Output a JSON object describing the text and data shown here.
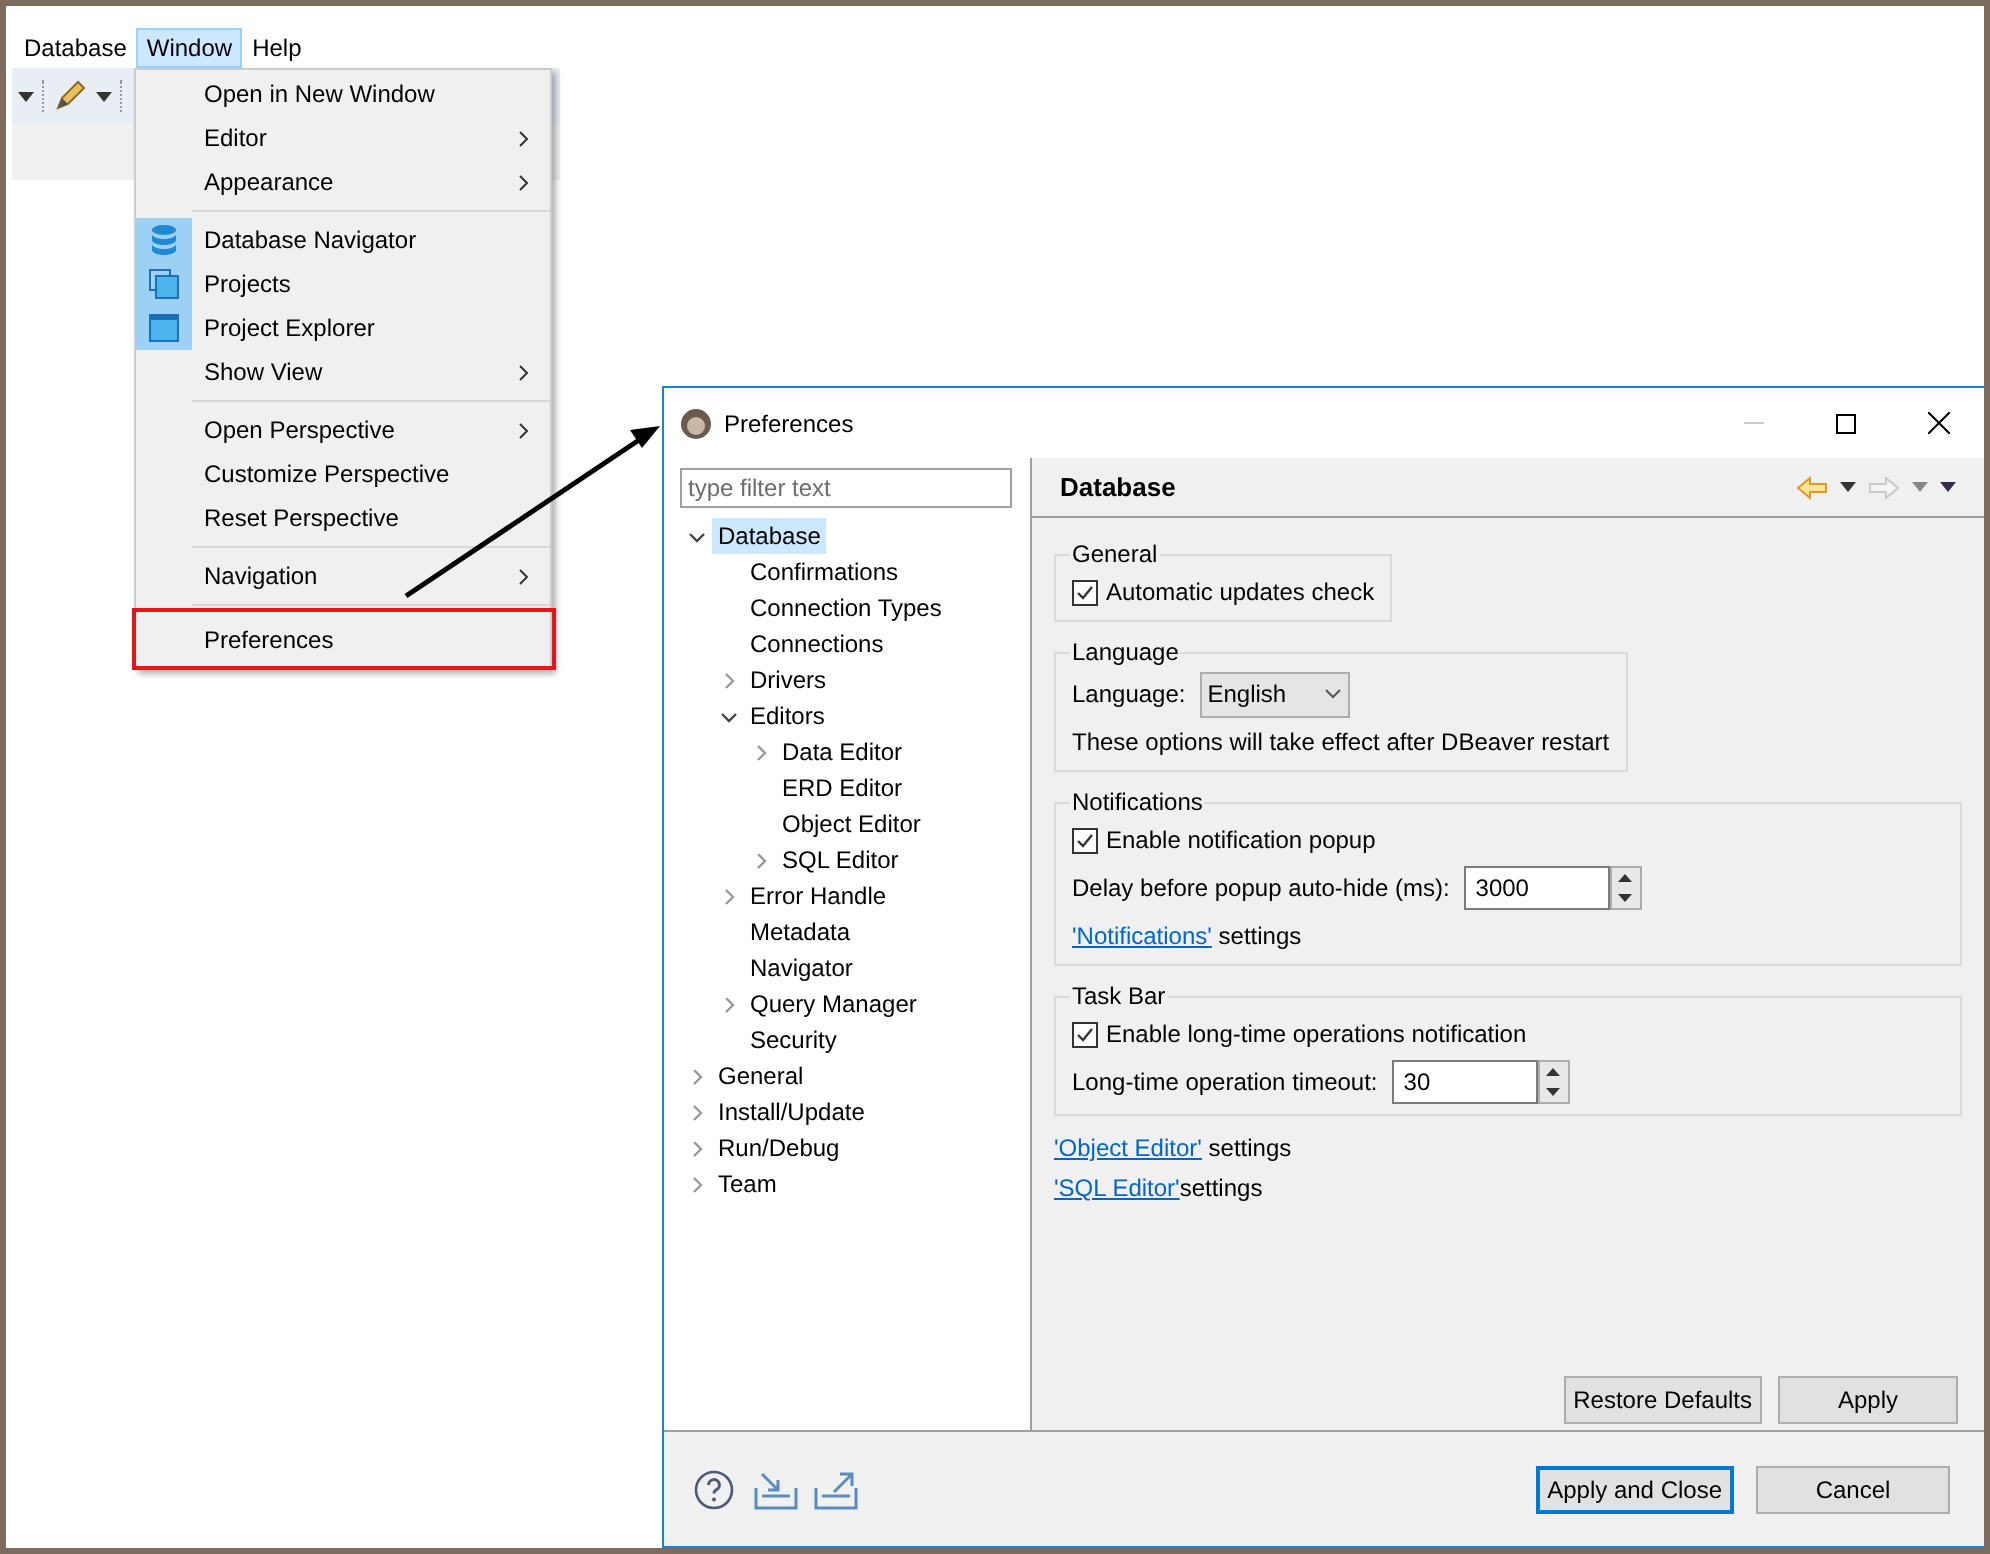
{
  "menu_bar": [
    {
      "label": "Database",
      "selected": false
    },
    {
      "label": "Window",
      "selected": true
    },
    {
      "label": "Help",
      "selected": false
    }
  ],
  "menu": {
    "groups": [
      [
        {
          "label": "Open in New Window",
          "submenu": false,
          "icon": false,
          "highlighted": false
        },
        {
          "label": "Editor",
          "submenu": true,
          "icon": false,
          "highlighted": false
        },
        {
          "label": "Appearance",
          "submenu": true,
          "icon": false,
          "highlighted": false
        }
      ],
      [
        {
          "label": "Database Navigator",
          "submenu": false,
          "icon": true,
          "highlighted": false
        },
        {
          "label": "Projects",
          "submenu": false,
          "icon": true,
          "highlighted": false
        },
        {
          "label": "Project Explorer",
          "submenu": false,
          "icon": true,
          "highlighted": false
        },
        {
          "label": "Show View",
          "submenu": true,
          "icon": false,
          "highlighted": false
        }
      ],
      [
        {
          "label": "Open Perspective",
          "submenu": true,
          "icon": false,
          "highlighted": false
        },
        {
          "label": "Customize Perspective",
          "submenu": false,
          "icon": false,
          "highlighted": false
        },
        {
          "label": "Reset Perspective",
          "submenu": false,
          "icon": false,
          "highlighted": false
        }
      ],
      [
        {
          "label": "Navigation",
          "submenu": true,
          "icon": false,
          "highlighted": false
        }
      ],
      [
        {
          "label": "Preferences",
          "submenu": false,
          "icon": false,
          "highlighted": true
        }
      ]
    ]
  },
  "dialog": {
    "title": "Preferences",
    "filter": {
      "placeholder": "type filter text"
    },
    "tree": [
      {
        "label": "Database",
        "selected": true,
        "expanded": true,
        "children": [
          {
            "label": "Confirmations",
            "selected": false
          },
          {
            "label": "Connection Types",
            "selected": false
          },
          {
            "label": "Connections",
            "selected": false
          },
          {
            "label": "Drivers",
            "selected": false,
            "expanded": false
          },
          {
            "label": "Editors",
            "selected": false,
            "expanded": true,
            "children": [
              {
                "label": "Data Editor",
                "selected": false,
                "expanded": false
              },
              {
                "label": "ERD Editor",
                "selected": false
              },
              {
                "label": "Object Editor",
                "selected": false
              },
              {
                "label": "SQL Editor",
                "selected": false,
                "expanded": false
              }
            ]
          },
          {
            "label": "Error Handle",
            "selected": false,
            "expanded": false
          },
          {
            "label": "Metadata",
            "selected": false
          },
          {
            "label": "Navigator",
            "selected": false
          },
          {
            "label": "Query Manager",
            "selected": false,
            "expanded": false
          },
          {
            "label": "Security",
            "selected": false
          }
        ]
      },
      {
        "label": "General",
        "selected": false,
        "expanded": false
      },
      {
        "label": "Install/Update",
        "selected": false,
        "expanded": false
      },
      {
        "label": "Run/Debug",
        "selected": false,
        "expanded": false
      },
      {
        "label": "Team",
        "selected": false,
        "expanded": false
      }
    ],
    "page_title": "Database",
    "groups": [
      {
        "title": "General",
        "rows": [
          {
            "kind": "checkbox",
            "label": "Automatic updates check",
            "checked": true
          }
        ]
      },
      {
        "title": "Language",
        "rows": [
          {
            "kind": "select",
            "label": "Language:",
            "value": "English"
          },
          {
            "kind": "text",
            "text": "These options will take effect after DBeaver restart"
          }
        ]
      },
      {
        "title": "Notifications",
        "rows": [
          {
            "kind": "checkbox",
            "label": "Enable notification popup",
            "checked": true
          },
          {
            "kind": "spinner",
            "label": "Delay before popup auto-hide (ms):",
            "value": "3000"
          },
          {
            "kind": "link",
            "link": "'Notifications'",
            "text": " settings"
          }
        ]
      },
      {
        "title": "Task Bar",
        "rows": [
          {
            "kind": "checkbox",
            "label": "Enable long-time operations notification",
            "checked": true
          },
          {
            "kind": "spinner",
            "label": "Long-time operation timeout:",
            "value": "30"
          }
        ]
      }
    ],
    "links": [
      {
        "link": "'Object Editor'",
        "text": " settings"
      },
      {
        "link": "'SQL Editor'",
        "text": "settings"
      }
    ],
    "page_buttons": [
      {
        "label": "Restore Defaults",
        "default": false
      },
      {
        "label": "Apply",
        "default": false
      }
    ],
    "buttons": [
      {
        "label": "Apply and Close",
        "default": true
      },
      {
        "label": "Cancel",
        "default": false
      }
    ]
  }
}
